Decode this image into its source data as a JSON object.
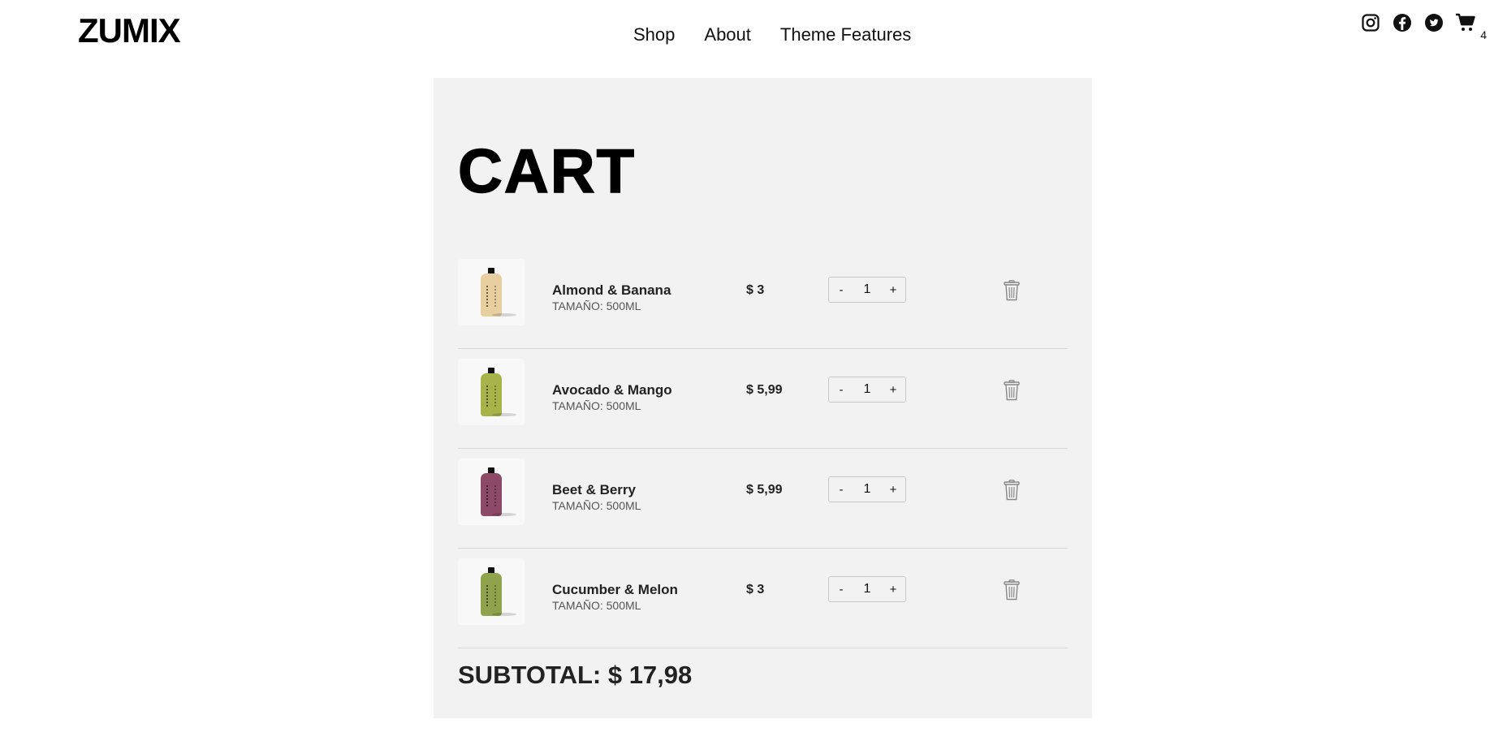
{
  "header": {
    "logo": "ZUMIX",
    "nav": [
      "Shop",
      "About",
      "Theme Features"
    ],
    "icons": [
      "instagram-icon",
      "facebook-icon",
      "twitter-icon",
      "cart-icon"
    ],
    "cart_count": "4"
  },
  "cart": {
    "title": "CART",
    "items": [
      {
        "name": "Almond & Banana",
        "size": "TAMAÑO: 500ML",
        "price": "$ 3",
        "qty": "1",
        "minus": "-",
        "plus": "+",
        "color": "#e8cfa0"
      },
      {
        "name": "Avocado & Mango",
        "size": "TAMAÑO: 500ML",
        "price": "$ 5,99",
        "qty": "1",
        "minus": "-",
        "plus": "+",
        "color": "#a7b44a"
      },
      {
        "name": "Beet & Berry",
        "size": "TAMAÑO: 500ML",
        "price": "$ 5,99",
        "qty": "1",
        "minus": "-",
        "plus": "+",
        "color": "#8c4a68"
      },
      {
        "name": "Cucumber & Melon",
        "size": "TAMAÑO: 500ML",
        "price": "$ 3",
        "qty": "1",
        "minus": "-",
        "plus": "+",
        "color": "#8fa34c"
      }
    ],
    "subtotal": "SUBTOTAL: $ 17,98"
  }
}
